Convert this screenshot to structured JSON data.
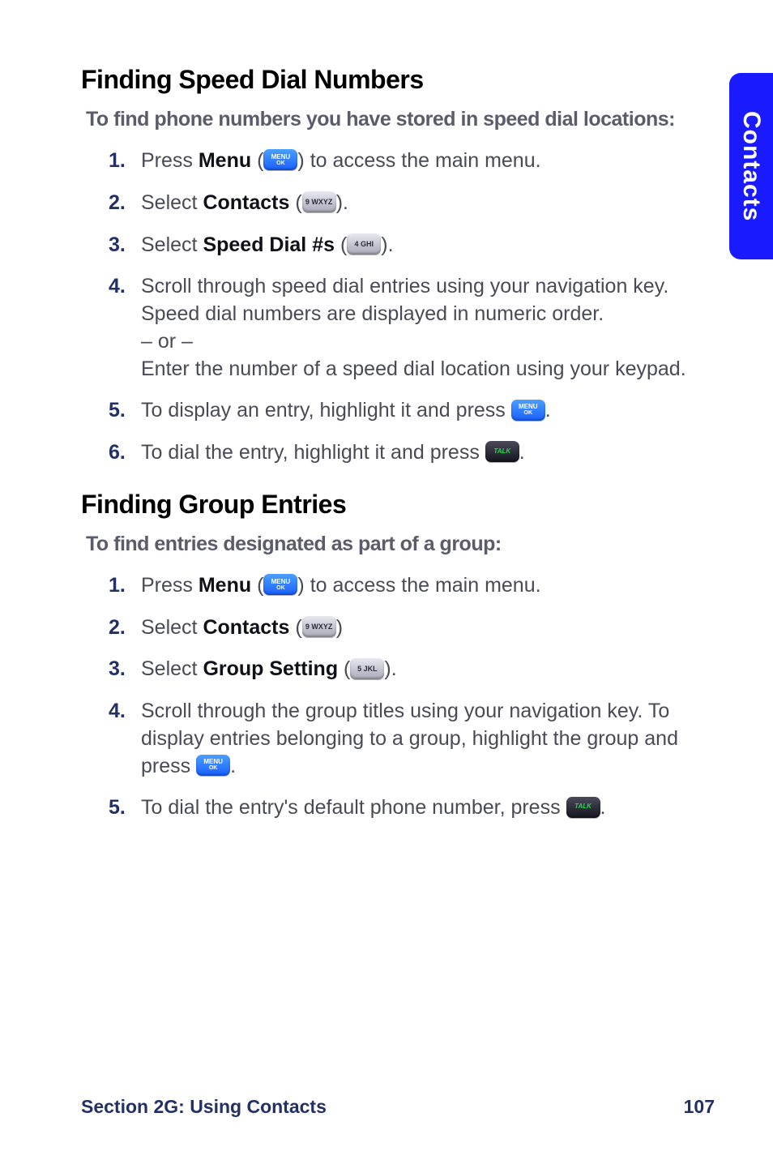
{
  "sideTab": "Contacts",
  "section1": {
    "heading": "Finding Speed Dial Numbers",
    "sub": "To find phone numbers you have stored in speed dial locations:",
    "s1": {
      "t1": "Press ",
      "b": "Menu",
      "t2": " (",
      "t3": ") to access the main menu."
    },
    "s2": {
      "t1": "Select ",
      "b": "Contacts",
      "t2": " (",
      "key": "9 WXYZ",
      "t3": ")."
    },
    "s3": {
      "t1": "Select ",
      "b": "Speed Dial #s",
      "t2": " (",
      "key": "4 GHI",
      "t3": ")."
    },
    "s4": {
      "l1": "Scroll through speed dial entries using your navigation key. Speed dial numbers are displayed in numeric order.",
      "or": "– or –",
      "l2": "Enter the number of a speed dial location using your keypad."
    },
    "s5": {
      "t1": "To display an entry, highlight it and press ",
      "t2": "."
    },
    "s6": {
      "t1": "To dial the entry, highlight it and press ",
      "t2": "."
    }
  },
  "section2": {
    "heading": "Finding Group Entries",
    "sub": "To find entries designated as part of a group:",
    "s1": {
      "t1": "Press ",
      "b": "Menu",
      "t2": " (",
      "t3": ") to access the main menu."
    },
    "s2": {
      "t1": "Select ",
      "b": "Contacts",
      "t2": " (",
      "key": "9 WXYZ",
      "t3": ")"
    },
    "s3": {
      "t1": "Select ",
      "b": "Group Setting",
      "t2": " (",
      "key": "5 JKL",
      "t3": ")."
    },
    "s4": {
      "t1": "Scroll through the group titles using your navigation key. To display entries belonging to a group, highlight the group and press ",
      "t2": "."
    },
    "s5": {
      "t1": "To dial the entry's default phone number, press ",
      "t2": "."
    }
  },
  "footer": {
    "left": "Section 2G: Using Contacts",
    "right": "107"
  },
  "keys": {
    "menuTop": "MENU",
    "menuBottom": "OK",
    "talk": "TALK"
  }
}
